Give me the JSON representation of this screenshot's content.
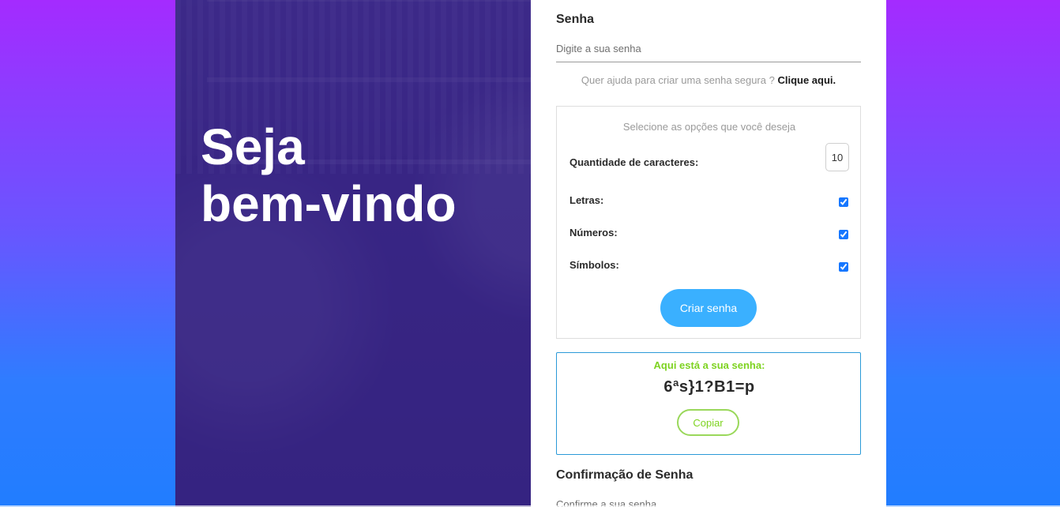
{
  "hero": {
    "title_line1": "Seja",
    "title_line2": "bem-vindo"
  },
  "password": {
    "title": "Senha",
    "placeholder": "Digite a sua senha",
    "help_text": "Quer ajuda para criar uma senha segura ?",
    "help_link": "Clique aqui."
  },
  "options": {
    "title": "Selecione as opções que você deseja",
    "quantity_label": "Quantidade de caracteres:",
    "quantity_value": "10",
    "letters_label": "Letras:",
    "numbers_label": "Números:",
    "symbols_label": "Símbolos:",
    "create_button": "Criar senha",
    "letters_checked": true,
    "numbers_checked": true,
    "symbols_checked": true
  },
  "result": {
    "label": "Aqui está a sua senha:",
    "value": "6ªs}1?B1=p",
    "copy_button": "Copiar"
  },
  "confirm": {
    "title": "Confirmação de Senha",
    "placeholder": "Confirme a sua senha"
  },
  "colors": {
    "accent_blue": "#3ab0ff",
    "accent_green": "#7ed321",
    "result_border": "#2b9ad8",
    "hero_overlay": "#3a2691"
  }
}
